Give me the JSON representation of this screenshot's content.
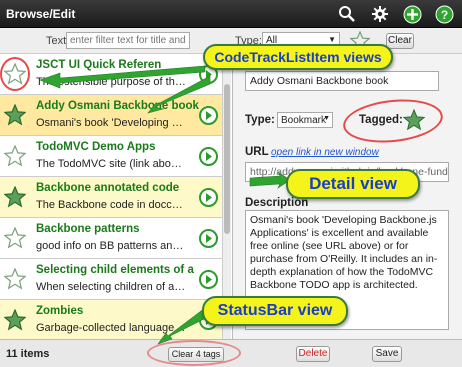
{
  "header": {
    "title": "Browse/Edit",
    "icons": [
      "search-icon",
      "gear-icon",
      "plus-icon",
      "help-icon"
    ]
  },
  "filter": {
    "text_label": "Text:",
    "text_placeholder": "enter filter text for title and description",
    "type_label": "Type:",
    "type_value": "All",
    "clear_label": "Clear"
  },
  "items": [
    {
      "title": "JSCT UI Quick Referen",
      "desc": "The ostensible purpose of this dev",
      "tagged": false,
      "selected": false
    },
    {
      "title": "Addy Osmani Backbone book",
      "desc": "Osmani's book 'Developing Backbo",
      "tagged": true,
      "selected": true
    },
    {
      "title": "TodoMVC Demo Apps",
      "desc": "The TodoMVC site (link above) let",
      "tagged": false,
      "selected": false
    },
    {
      "title": "Backbone annotated code",
      "desc": "The Backbone code in docco 2 c",
      "tagged": true,
      "selected": false
    },
    {
      "title": "Backbone patterns",
      "desc": "good info on BB patterns and best",
      "tagged": false,
      "selected": false
    },
    {
      "title": "Selecting child elements of a",
      "desc": "When selecting children of a view",
      "tagged": false,
      "selected": false
    },
    {
      "title": "Zombies",
      "desc": "Garbage-collected languages are",
      "tagged": true,
      "selected": false
    }
  ],
  "detail": {
    "title_value": "Addy Osmani Backbone book",
    "type_label": "Type:",
    "type_value": "Bookmark",
    "tagged_label": "Tagged:",
    "url_label": "URL",
    "url_link": "open link in new window",
    "url_value": "http://addyosmani.github.io/backbone-fundament",
    "desc_label": "Description",
    "desc_text": "Osmani's book 'Developing Backbone.js Applications' is excellent and available free online (see URL above) or for purchase from O'Reilly. It includes an in-depth explanation of how the TodoMVC Backbone TODO app is architected."
  },
  "status": {
    "count": "11 items",
    "clear_tags": "Clear 4 tags",
    "delete": "Delete",
    "save": "Save"
  },
  "callouts": {
    "list_view": "CodeTrackListItem views",
    "detail_view": "Detail view",
    "statusbar_view": "StatusBar view"
  },
  "colors": {
    "header_bg": "#2a2a2a",
    "tagged_bg": "#fdf9c8",
    "selected_bg": "#ffe9a0",
    "title_green": "#1a7a1a",
    "callout_yellow": "#f4f41a",
    "callout_text": "#1a3ec8",
    "delete_red": "#cc2222"
  }
}
